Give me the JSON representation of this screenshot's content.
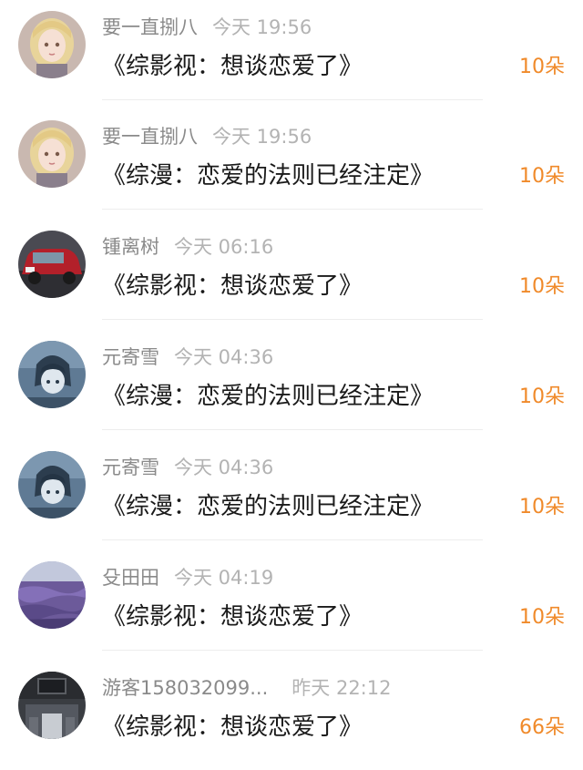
{
  "gifts": [
    {
      "username": "要一直捌八",
      "time": "今天 19:56",
      "title": "《综影视：想谈恋爱了》",
      "count": "10朵",
      "avatar_icon": "anime-girl-blonde-avatar"
    },
    {
      "username": "要一直捌八",
      "time": "今天 19:56",
      "title": "《综漫：恋爱的法则已经注定》",
      "count": "10朵",
      "avatar_icon": "anime-girl-blonde-avatar"
    },
    {
      "username": "锺离树",
      "time": "今天 06:16",
      "title": "《综影视：想谈恋爱了》",
      "count": "10朵",
      "avatar_icon": "red-car-avatar"
    },
    {
      "username": "元寄雪",
      "time": "今天 04:36",
      "title": "《综漫：恋爱的法则已经注定》",
      "count": "10朵",
      "avatar_icon": "anime-character-blue-avatar"
    },
    {
      "username": "元寄雪",
      "time": "今天 04:36",
      "title": "《综漫：恋爱的法则已经注定》",
      "count": "10朵",
      "avatar_icon": "anime-character-blue-avatar"
    },
    {
      "username": "殳田田",
      "time": "今天 04:19",
      "title": "《综影视：想谈恋爱了》",
      "count": "10朵",
      "avatar_icon": "lavender-field-avatar"
    },
    {
      "username": "游客158032099...",
      "time": "昨天 22:12",
      "title": "《综影视：想谈恋爱了》",
      "count": "66朵",
      "avatar_icon": "dark-interior-avatar"
    }
  ],
  "colors": {
    "count_accent": "#f08a2a",
    "username": "#8a8a8a",
    "time": "#b3b3b3",
    "title": "#1a1a1a"
  }
}
